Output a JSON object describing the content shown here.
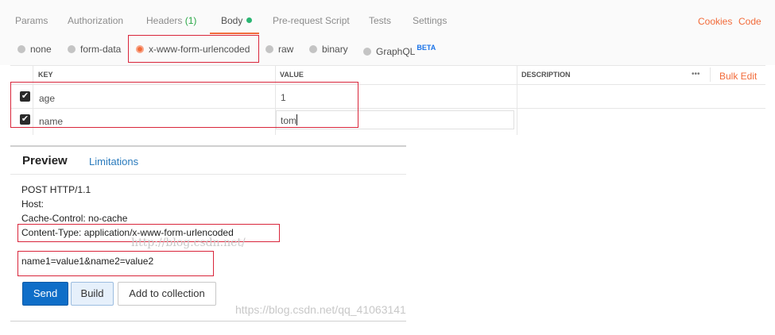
{
  "tabs": {
    "params": "Params",
    "authorization": "Authorization",
    "headers_label": "Headers",
    "headers_count": "(1)",
    "body": "Body",
    "prerequest": "Pre-request Script",
    "tests": "Tests",
    "settings": "Settings",
    "cookies": "Cookies",
    "code": "Code"
  },
  "body_types": {
    "none": "none",
    "form_data": "form-data",
    "urlencoded": "x-www-form-urlencoded",
    "raw": "raw",
    "binary": "binary",
    "graphql": "GraphQL",
    "beta": "BETA",
    "selected": "x-www-form-urlencoded"
  },
  "table": {
    "headers": {
      "key": "KEY",
      "value": "VALUE",
      "description": "DESCRIPTION"
    },
    "more": "•••",
    "bulk_edit": "Bulk Edit",
    "rows": [
      {
        "checked": true,
        "key": "age",
        "value": "1"
      },
      {
        "checked": true,
        "key": "name",
        "value": "tom"
      }
    ]
  },
  "preview": {
    "title": "Preview",
    "limitations": "Limitations",
    "lines": [
      "POST HTTP/1.1",
      "Host:",
      "Cache-Control: no-cache",
      "Content-Type: application/x-www-form-urlencoded",
      "name1=value1&name2=value2"
    ],
    "buttons": {
      "send": "Send",
      "build": "Build",
      "add": "Add to collection"
    }
  },
  "watermarks": {
    "mid": "http://blog.csdn.net/",
    "bottom": "https://blog.csdn.net/qq_41063141"
  },
  "colors": {
    "accent": "#f26b3a",
    "highlight_box": "#d9263b",
    "send_button": "#0f6ec8",
    "link": "#2b7bbd"
  }
}
